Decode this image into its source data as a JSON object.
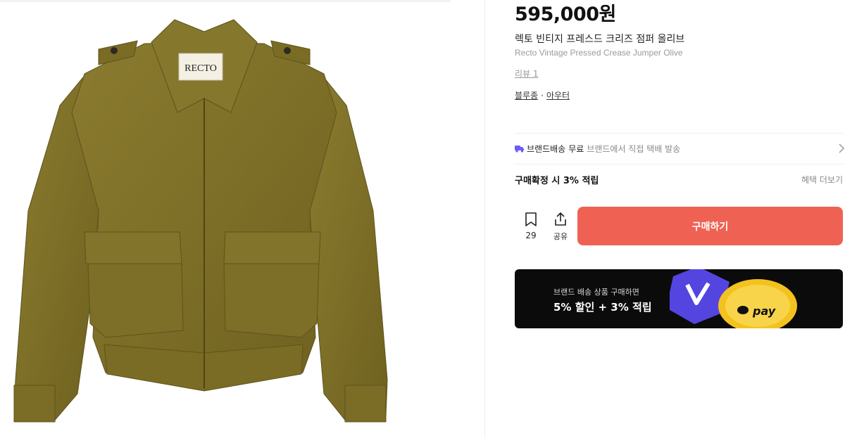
{
  "product": {
    "price": "595,000원",
    "name_ko": "렉토 빈티지 프레스드 크리즈 점퍼 올리브",
    "name_en": "Recto Vintage Pressed Crease Jumper Olive",
    "review_link": "리뷰 1",
    "categories": [
      "블루종",
      "아우터"
    ],
    "category_separator": "·",
    "image_label": "RECTO",
    "image_icon": "jacket-photo"
  },
  "shipping": {
    "title": "브랜드배송",
    "free_label": "무료",
    "description": "브랜드에서 직접 택배 발송",
    "icon": "truck-icon",
    "accent_color": "#6b5cff"
  },
  "points": {
    "text": "구매확정 시 3% 적립",
    "benefits_link": "혜택 더보기"
  },
  "actions": {
    "bookmark_count": "29",
    "share_label": "공유",
    "buy_label": "구매하기",
    "buy_color": "#ef6253"
  },
  "banner": {
    "line1": "브랜드 배송 상품 구매하면",
    "line2": "5% 할인 + 3% 적립",
    "coin_text": "pay",
    "background": "#0b0b0b"
  }
}
